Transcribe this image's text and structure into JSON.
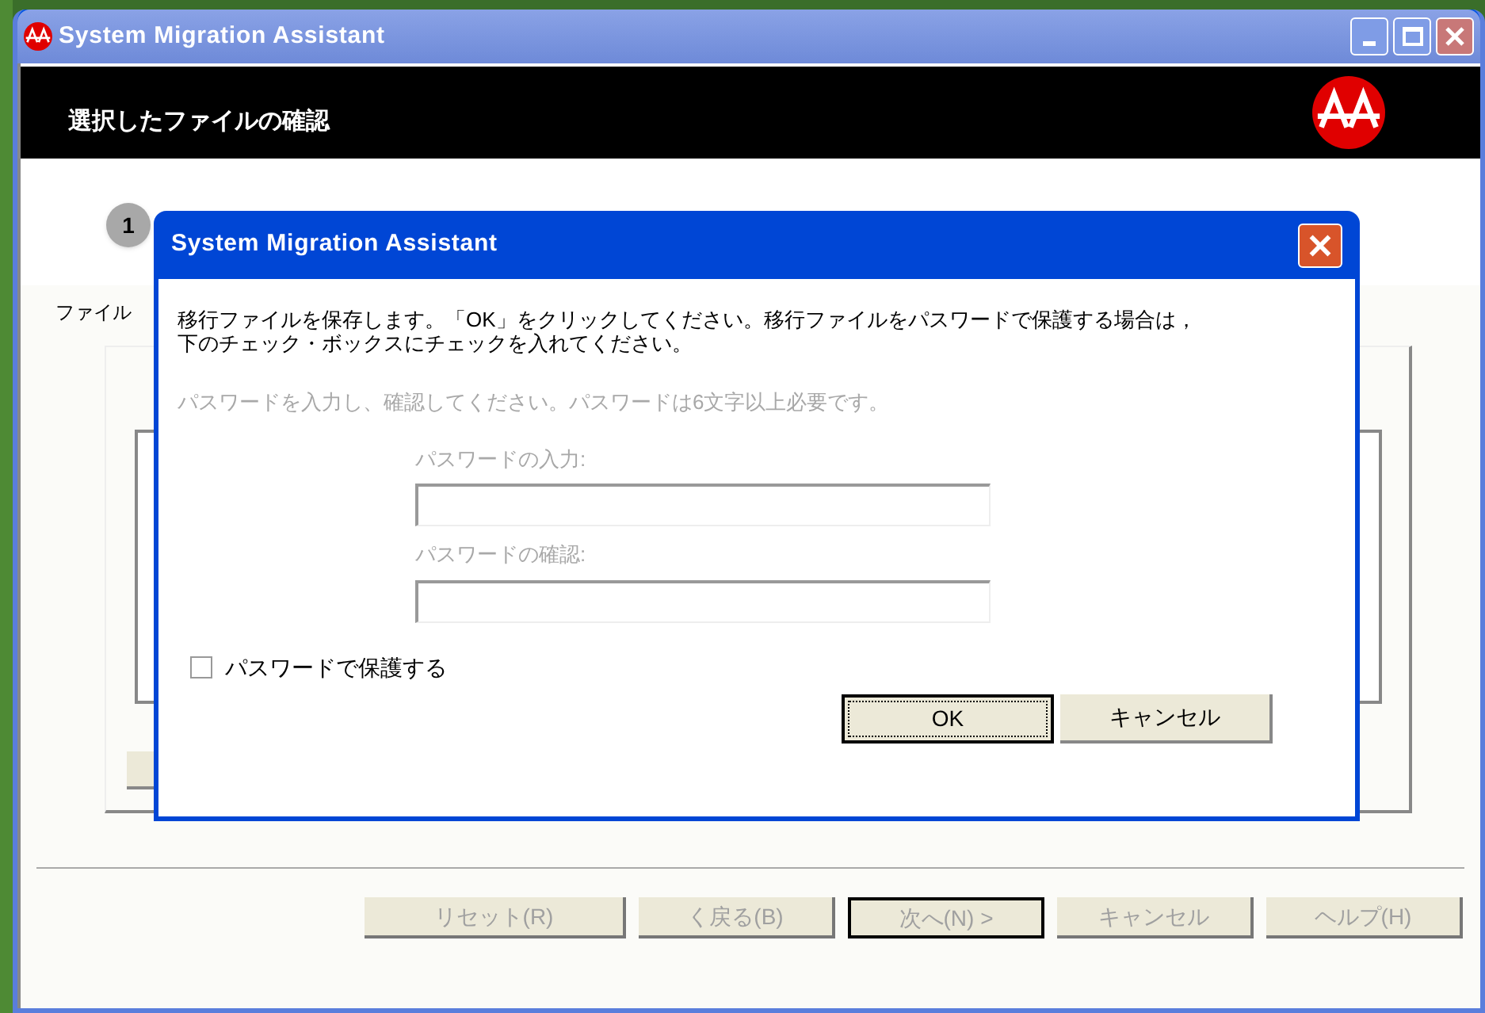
{
  "window": {
    "title": "System Migration Assistant"
  },
  "header": {
    "title": "選択したファイルの確認"
  },
  "step": {
    "number": "1"
  },
  "content": {
    "label": "ファイル"
  },
  "footer_buttons": [
    {
      "label": "リセット(R)",
      "disabled": true,
      "default": false
    },
    {
      "label": "く戻る(B)",
      "disabled": true,
      "default": false
    },
    {
      "label": "次へ(N) >",
      "disabled": true,
      "default": true
    },
    {
      "label": "キャンセル",
      "disabled": true,
      "default": false
    },
    {
      "label": "ヘルプ(H)",
      "disabled": true,
      "default": false
    }
  ],
  "dialog": {
    "title": "System Migration Assistant",
    "message": "移行ファイルを保存します。「OK」をクリックしてください。移行ファイルをパスワードで保護する場合は，下のチェック・ボックスにチェックを入れてください。",
    "password_section": {
      "disabled": true,
      "hint": "パスワードを入力し、確認してください。パスワードは6文字以上必要です。",
      "fields": [
        {
          "label": "パスワードの入力:"
        },
        {
          "label": "パスワードの確認:"
        }
      ]
    },
    "protect_checkbox": {
      "label": "パスワードで保護する",
      "checked": false
    },
    "buttons": [
      {
        "label": "OK",
        "default": true
      },
      {
        "label": "キャンセル",
        "default": false
      }
    ]
  }
}
